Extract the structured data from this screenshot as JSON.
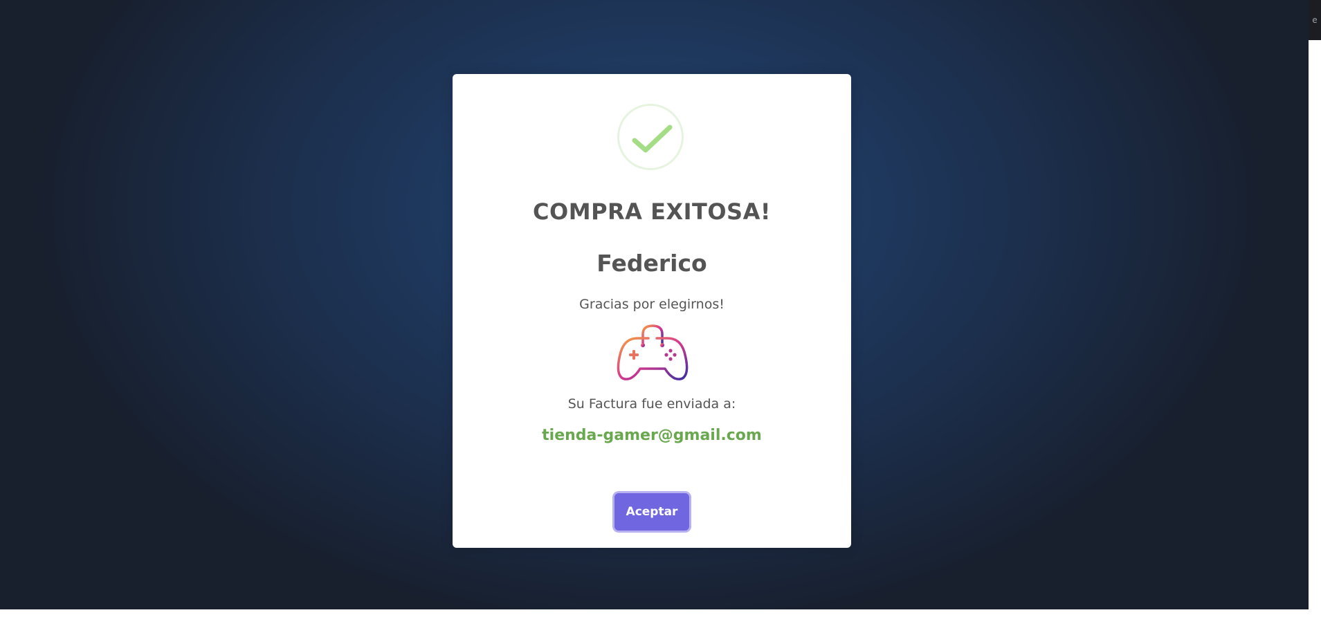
{
  "modal": {
    "title": "COMPRA EXITOSA!",
    "customer_name": "Federico",
    "thanks_message": "Gracias por elegirnos!",
    "invoice_label": "Su Factura fue enviada a:",
    "email": "tienda-gamer@gmail.com",
    "accept_label": "Aceptar",
    "icons": {
      "status": "success-check-icon",
      "product": "gamepad-bag-icon"
    }
  },
  "corner_text": "e",
  "colors": {
    "accent": "#7066e0",
    "success": "#6aa84f",
    "text": "#545454",
    "backdrop": "#1f3a61"
  }
}
